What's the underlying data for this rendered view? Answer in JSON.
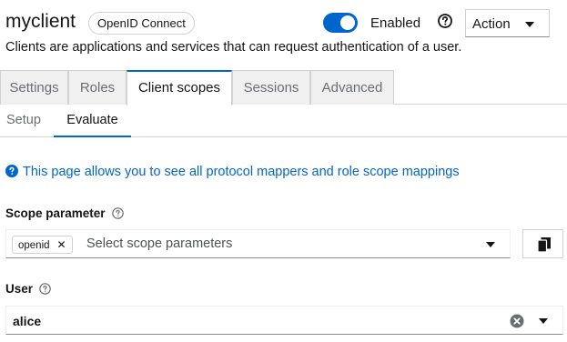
{
  "header": {
    "client_name": "myclient",
    "protocol_badge": "OpenID Connect",
    "enabled_label": "Enabled",
    "enabled": true,
    "action_label": "Action",
    "description": "Clients are applications and services that can request authentication of a user."
  },
  "tabs": [
    {
      "label": "Settings",
      "active": false
    },
    {
      "label": "Roles",
      "active": false
    },
    {
      "label": "Client scopes",
      "active": true
    },
    {
      "label": "Sessions",
      "active": false
    },
    {
      "label": "Advanced",
      "active": false
    }
  ],
  "subtabs": [
    {
      "label": "Setup",
      "active": false
    },
    {
      "label": "Evaluate",
      "active": true
    }
  ],
  "info": {
    "text": "This page allows you to see all protocol mappers and role scope mappings",
    "icon": "question-circle-icon"
  },
  "scope_parameter": {
    "label": "Scope parameter",
    "chip": "openid",
    "chip_close": "✕",
    "placeholder": "Select scope parameters"
  },
  "user": {
    "label": "User",
    "value": "alice"
  },
  "colors": {
    "accent": "#0066cc",
    "text": "#151515",
    "muted": "#6a6e73",
    "border": "#d2d2d2"
  }
}
